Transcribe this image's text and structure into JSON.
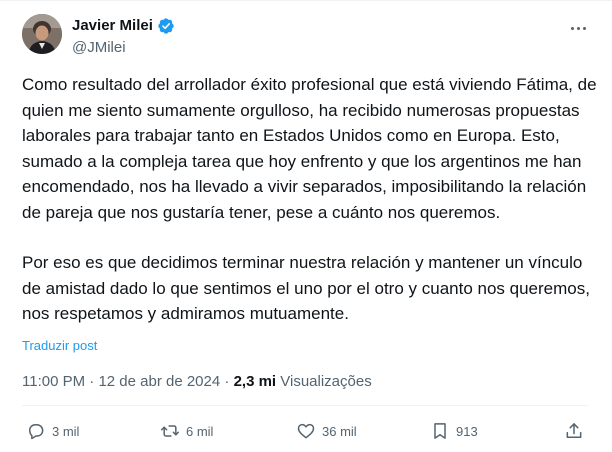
{
  "colors": {
    "accent": "#1d9bf0",
    "text_primary": "#0f1419",
    "text_secondary": "#536471",
    "verified": "#1d9bf0"
  },
  "author": {
    "name": "Javier Milei",
    "handle": "@JMilei",
    "verified": true,
    "avatar_icon": "profile-photo"
  },
  "tweet": {
    "paragraphs": [
      "Como resultado del arrollador éxito profesional que está viviendo Fátima, de quien me siento sumamente orgulloso, ha recibido numerosas propuestas laborales para trabajar tanto en Estados Unidos como en Europa. Esto, sumado a la compleja tarea que hoy enfrento y que los argentinos me han encomendado, nos ha llevado a vivir separados, imposibilitando la relación de pareja que nos gustaría tener, pese a cuánto nos queremos.",
      "Por eso es que decidimos terminar nuestra relación y mantener un vínculo de amistad dado lo que sentimos el uno por el otro y cuanto nos queremos, nos respetamos y admiramos mutuamente."
    ],
    "translate_label": "Traduzir post"
  },
  "meta": {
    "time": "11:00 PM",
    "separator": "·",
    "date": "12 de abr de 2024",
    "views_count": "2,3 mi",
    "views_label": "Visualizações"
  },
  "actions": {
    "replies": {
      "icon": "reply-icon",
      "count": "3 mil"
    },
    "reposts": {
      "icon": "repost-icon",
      "count": "6 mil"
    },
    "likes": {
      "icon": "like-icon",
      "count": "36 mil"
    },
    "bookmarks": {
      "icon": "bookmark-icon",
      "count": "913"
    },
    "share": {
      "icon": "share-icon"
    }
  }
}
